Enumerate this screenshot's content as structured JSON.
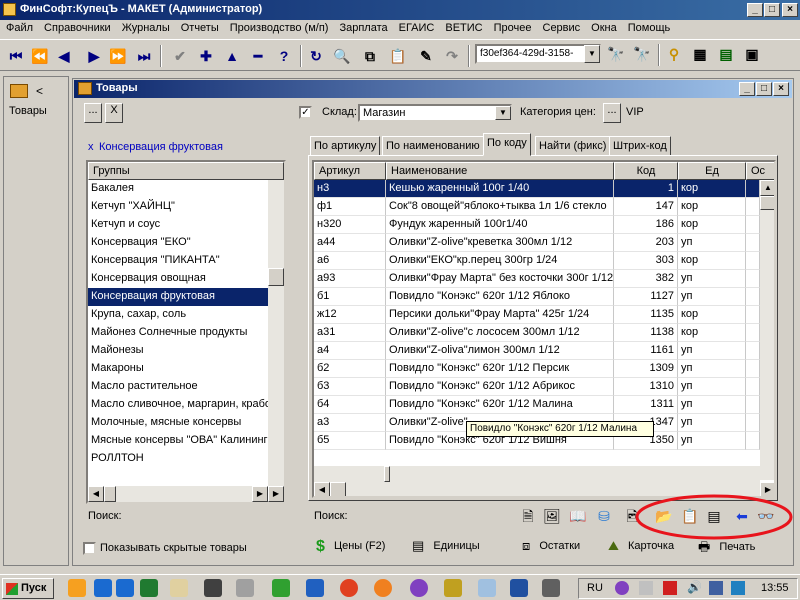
{
  "app": {
    "title": "ФинСофт:КупецЪ - МАКЕТ  (Администратор)"
  },
  "menu": [
    "Файл",
    "Справочники",
    "Журналы",
    "Отчеты",
    "Производство (м/п)",
    "Зарплата",
    "ЕГАИС",
    "ВЕТИС",
    "Прочее",
    "Сервис",
    "Окна",
    "Помощь"
  ],
  "toolbar": {
    "guid_value": "f30ef364-429d-3158-"
  },
  "leftpanel": {
    "label": "Товары",
    "back": "<"
  },
  "window": {
    "title": "Товары",
    "dots_button": "...",
    "clear_button": "X",
    "warehouse_checked": "✓",
    "warehouse_label": "Склад:",
    "warehouse_value": "Магазин",
    "price_category_label": "Категория цен:",
    "price_category_button": "...",
    "price_category_value": "VIP",
    "filter_marker": "x",
    "filter_text": "Консервация фруктовая",
    "groups_header": "Группы",
    "groups": [
      "Бакалея",
      "Кетчуп \"ХАЙНЦ\"",
      "Кетчуп и соус",
      "Консервация \"ЕКО\"",
      "Консервация \"ПИКАНТА\"",
      "Консервация овощная",
      "Консервация фруктовая",
      "Крупа, сахар, соль",
      "Майонез Солнечные продукты",
      "Майонезы",
      "Макароны",
      "Масло растительное",
      "Масло сливочное, маргарин, крабовые палочки",
      "Молочные, мясные консервы",
      "Мясные консервы \"ОВА\" Калининград",
      "РОЛЛТОН"
    ],
    "selected_group_index": 6,
    "tabs": [
      "По артикулу",
      "По наименованию",
      "По коду",
      "Найти (фикс)",
      "Штрих-код"
    ],
    "active_tab_index": 2,
    "columns": [
      "Артикул",
      "Наименование",
      "Код",
      "Ед",
      "Ос"
    ],
    "products": [
      {
        "art": "н3",
        "name": "Кешью жаренный 100г 1/40",
        "code": "1",
        "unit": "кор"
      },
      {
        "art": "ф1",
        "name": "Сок\"8 овощей\"яблоко+тыква 1л 1/6 стекло",
        "code": "147",
        "unit": "кор"
      },
      {
        "art": "н320",
        "name": "Фундук жаренный 100г1/40",
        "code": "186",
        "unit": "кор"
      },
      {
        "art": "а44",
        "name": "Оливки\"Z-olive\"креветка 300мл 1/12",
        "code": "203",
        "unit": "уп"
      },
      {
        "art": "а6",
        "name": "Оливки\"ЕКО\"кр.перец 300гр 1/24",
        "code": "303",
        "unit": "кор"
      },
      {
        "art": "а93",
        "name": "Оливки\"Фрау Марта\" без косточки 300г 1/12",
        "code": "382",
        "unit": "уп"
      },
      {
        "art": "б1",
        "name": "Повидло \"Конэкс\"  620г 1/12 Яблоко",
        "code": "1127",
        "unit": "уп"
      },
      {
        "art": "ж12",
        "name": "Персики дольки\"Фрау Марта\" 425г 1/24",
        "code": "1135",
        "unit": "кор"
      },
      {
        "art": "а31",
        "name": "Оливки\"Z-olive\"с лососем 300мл 1/12",
        "code": "1138",
        "unit": "кор"
      },
      {
        "art": "а4",
        "name": "Оливки\"Z-oliva\"лимон 300мл 1/12",
        "code": "1161",
        "unit": "уп"
      },
      {
        "art": "б2",
        "name": "Повидло \"Конэкс\"  620г 1/12 Персик",
        "code": "1309",
        "unit": "уп"
      },
      {
        "art": "б3",
        "name": "Повидло \"Конэкс\"  620г 1/12 Абрикос",
        "code": "1310",
        "unit": "уп"
      },
      {
        "art": "б4",
        "name": "Повидло \"Конэкс\"  620г 1/12 Малина",
        "code": "1311",
        "unit": "уп"
      },
      {
        "art": "а3",
        "name": "Оливки\"Z-olive\"",
        "code": "1347",
        "unit": "уп"
      },
      {
        "art": "б5",
        "name": "Повидло \"Конэкс\"  620г 1/12 Вишня",
        "code": "1350",
        "unit": "уп"
      }
    ],
    "selected_product_index": 0,
    "tooltip": "Повидло \"Конэкс\"  620г 1/12 Малина",
    "search_label_left": "Поиск:",
    "search_label_right": "Поиск:",
    "show_hidden_label": "Показывать скрытые товары",
    "bottom_buttons": {
      "prices": "Цены (F2)",
      "units": "Единицы",
      "stock": "Остатки",
      "card": "Карточка",
      "print": "Печать"
    },
    "highlight_color": "#e8141c"
  },
  "taskbar": {
    "start": "Пуск",
    "lang": "RU",
    "clock": "13:55"
  }
}
